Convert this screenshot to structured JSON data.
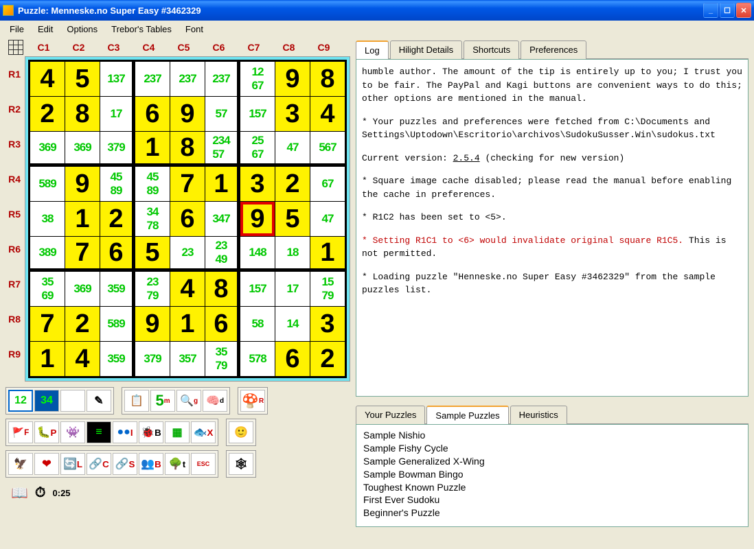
{
  "window": {
    "title": "Puzzle: Menneske.no Super Easy #3462329"
  },
  "menu": [
    "File",
    "Edit",
    "Options",
    "Trebor's Tables",
    "Font"
  ],
  "columns": [
    "C1",
    "C2",
    "C3",
    "C4",
    "C5",
    "C6",
    "C7",
    "C8",
    "C9"
  ],
  "rows": [
    "R1",
    "R2",
    "R3",
    "R4",
    "R5",
    "R6",
    "R7",
    "R8",
    "R9"
  ],
  "grid": [
    [
      {
        "v": "4",
        "s": 1
      },
      {
        "v": "5",
        "s": 1
      },
      {
        "c": "137"
      },
      {
        "c": "237"
      },
      {
        "c": "237"
      },
      {
        "c": "237"
      },
      {
        "c": "12\n67"
      },
      {
        "v": "9",
        "s": 1
      },
      {
        "v": "8",
        "s": 1
      }
    ],
    [
      {
        "v": "2",
        "s": 1
      },
      {
        "v": "8",
        "s": 1
      },
      {
        "c": "17"
      },
      {
        "v": "6",
        "s": 1
      },
      {
        "v": "9",
        "s": 1
      },
      {
        "c": "57"
      },
      {
        "c": "157"
      },
      {
        "v": "3",
        "s": 1
      },
      {
        "v": "4",
        "s": 1
      }
    ],
    [
      {
        "c": "369"
      },
      {
        "c": "369"
      },
      {
        "c": "379"
      },
      {
        "v": "1",
        "s": 1
      },
      {
        "v": "8",
        "s": 1
      },
      {
        "c": "234\n57"
      },
      {
        "c": "25\n67"
      },
      {
        "c": "47"
      },
      {
        "c": "567"
      }
    ],
    [
      {
        "c": "589"
      },
      {
        "v": "9",
        "s": 1
      },
      {
        "c": "45\n89"
      },
      {
        "c": "45\n89"
      },
      {
        "v": "7",
        "s": 1
      },
      {
        "v": "1",
        "s": 1
      },
      {
        "v": "3",
        "s": 1
      },
      {
        "v": "2",
        "s": 1
      },
      {
        "c": "67"
      }
    ],
    [
      {
        "c": "38"
      },
      {
        "v": "1",
        "s": 1
      },
      {
        "v": "2",
        "s": 1
      },
      {
        "c": "34\n78"
      },
      {
        "v": "6",
        "s": 1
      },
      {
        "c": "347"
      },
      {
        "v": "9",
        "s": 1,
        "sel": 1
      },
      {
        "v": "5",
        "s": 1
      },
      {
        "c": "47"
      }
    ],
    [
      {
        "c": "389"
      },
      {
        "v": "7",
        "s": 1
      },
      {
        "v": "6",
        "s": 1
      },
      {
        "v": "5",
        "s": 1
      },
      {
        "c": "23"
      },
      {
        "c": "23\n49"
      },
      {
        "c": "148"
      },
      {
        "c": "18"
      },
      {
        "v": "1",
        "s": 1
      }
    ],
    [
      {
        "c": "35\n69"
      },
      {
        "c": "369"
      },
      {
        "c": "359"
      },
      {
        "c": "23\n79"
      },
      {
        "v": "4",
        "s": 1
      },
      {
        "v": "8",
        "s": 1
      },
      {
        "c": "157"
      },
      {
        "c": "17"
      },
      {
        "c": "15\n79"
      }
    ],
    [
      {
        "v": "7",
        "s": 1
      },
      {
        "v": "2",
        "s": 1
      },
      {
        "c": "589"
      },
      {
        "v": "9",
        "s": 1
      },
      {
        "v": "1",
        "s": 1
      },
      {
        "v": "6",
        "s": 1
      },
      {
        "c": "58"
      },
      {
        "c": "14"
      },
      {
        "v": "3",
        "s": 1
      }
    ],
    [
      {
        "v": "1",
        "s": 1
      },
      {
        "v": "4",
        "s": 1
      },
      {
        "c": "359"
      },
      {
        "c": "379"
      },
      {
        "c": "357"
      },
      {
        "c": "35\n79"
      },
      {
        "c": "578"
      },
      {
        "v": "6",
        "s": 1
      },
      {
        "v": "2",
        "s": 1
      }
    ]
  ],
  "topTabs": [
    "Log",
    "Hilight Details",
    "Shortcuts",
    "Preferences"
  ],
  "topTabActive": 0,
  "log": {
    "p1": "humble author.  The amount of the tip is entirely up to you; I trust you to be fair.  The PayPal and Kagi buttons are convenient ways to do this; other options are mentioned in the manual.",
    "p2": "* Your puzzles and preferences were fetched from C:\\Documents and Settings\\Uptodown\\Escritorio\\archivos\\SudokuSusser.Win\\sudokus.txt",
    "p3a": "Current version: ",
    "p3b": "2.5.4",
    "p3c": " (checking for new version)",
    "p4": "* Square image cache disabled; please read the manual before enabling the cache in preferences.",
    "p5": "* R1C2 has been set to <5>.",
    "p6a": "* Setting R1C1 to <6> would invalidate original square R1C5.",
    "p6b": "This is not permitted.",
    "p7": "* Loading puzzle \"Henneske.no Super Easy #3462329\" from the sample puzzles list."
  },
  "bottomTabs": [
    "Your Puzzles",
    "Sample Puzzles",
    "Heuristics"
  ],
  "bottomTabActive": 1,
  "samples": [
    "Sample Nishio",
    "Sample Fishy Cycle",
    "Sample Generalized X-Wing",
    "Sample Bowman Bingo",
    "Toughest Known Puzzle",
    "First Ever Sudoku",
    "Beginner's Puzzle"
  ],
  "timer": "0:25",
  "toolbar1": [
    "12",
    "34",
    "",
    ""
  ],
  "toolbar1b": [
    "",
    "5",
    "",
    ""
  ]
}
